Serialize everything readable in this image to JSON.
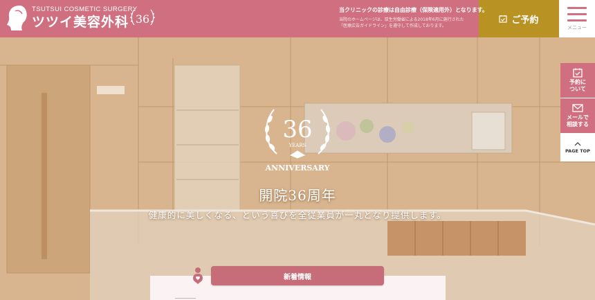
{
  "header": {
    "logo_en": "TSUTSUI COSMETIC SURGERY",
    "logo_jp": "ツツイ美容外科",
    "badge_number": "36",
    "notice_main": "当クリニックの診療は自由診療（保険適用外）となります。",
    "notice_sub_1": "当院のホームページは、厚生労働省による2018年6月に施行された",
    "notice_sub_2": "「医療広告ガイドライン」を遵守して作成しております。",
    "reserve_label": "ご予約",
    "menu_label": "メニュー"
  },
  "hero": {
    "emblem_number": "36",
    "emblem_years": "YEARS",
    "emblem_anniversary": "ANNIVERSARY",
    "title": "開院36周年",
    "subtitle": "健康的に美しくなる、という喜びを全従業員が一丸となり提供します。"
  },
  "side": {
    "reserve_info": "予約に\nついて",
    "mail_consult": "メールで\n相談する",
    "page_top": "PAGE TOP"
  },
  "news": {
    "tab_label": "新着情報"
  },
  "colors": {
    "brand_pink": "#cf6f7f",
    "gold": "#b99224",
    "news_tab": "#c76d7a"
  }
}
